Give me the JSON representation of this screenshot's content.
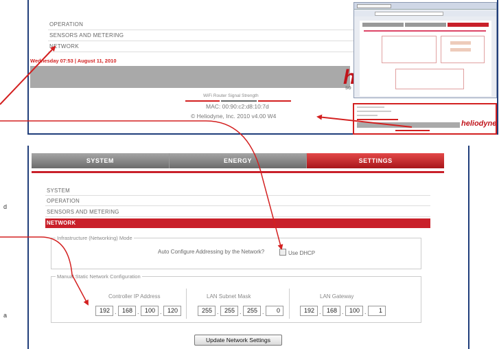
{
  "top": {
    "menu": [
      "OPERATION",
      "SENSORS AND METERING",
      "NETWORK"
    ],
    "date": "Wednesday 07:53 | August 11, 2010",
    "logo_partial": "he",
    "logo_sub": "SO",
    "signal_label": "WiFi Router Signal Strength",
    "mac": "MAC: 00:90:c2:d8:10:7d",
    "copyright": "© Heliodyne, Inc. 2010 v4.00 W4"
  },
  "zoom": {
    "logo": "heliodyne"
  },
  "tabs": [
    "SYSTEM",
    "ENERGY",
    "SETTINGS"
  ],
  "settings_menu": [
    "SYSTEM",
    "OPERATION",
    "SENSORS AND METERING",
    "NETWORK"
  ],
  "infra": {
    "legend": "Infrastructure (Networking) Mode",
    "question": "Auto Configure Addressing by the Network?",
    "checkbox_label": "Use DHCP"
  },
  "manual": {
    "legend": "Manual Static Network Configuration",
    "groups": [
      {
        "label": "Controller IP Address",
        "octets": [
          "192",
          "168",
          "100",
          "120"
        ]
      },
      {
        "label": "LAN Subnet Mask",
        "octets": [
          "255",
          "255",
          "255",
          "0"
        ]
      },
      {
        "label": "LAN Gateway",
        "octets": [
          "192",
          "168",
          "100",
          "1"
        ]
      }
    ]
  },
  "update_button": "Update Network Settings",
  "side_letters": [
    "d",
    "a"
  ],
  "colors": {
    "brand_red": "#c9202a",
    "frame_blue": "#1f3d7a",
    "arrow_red": "#d32020"
  }
}
